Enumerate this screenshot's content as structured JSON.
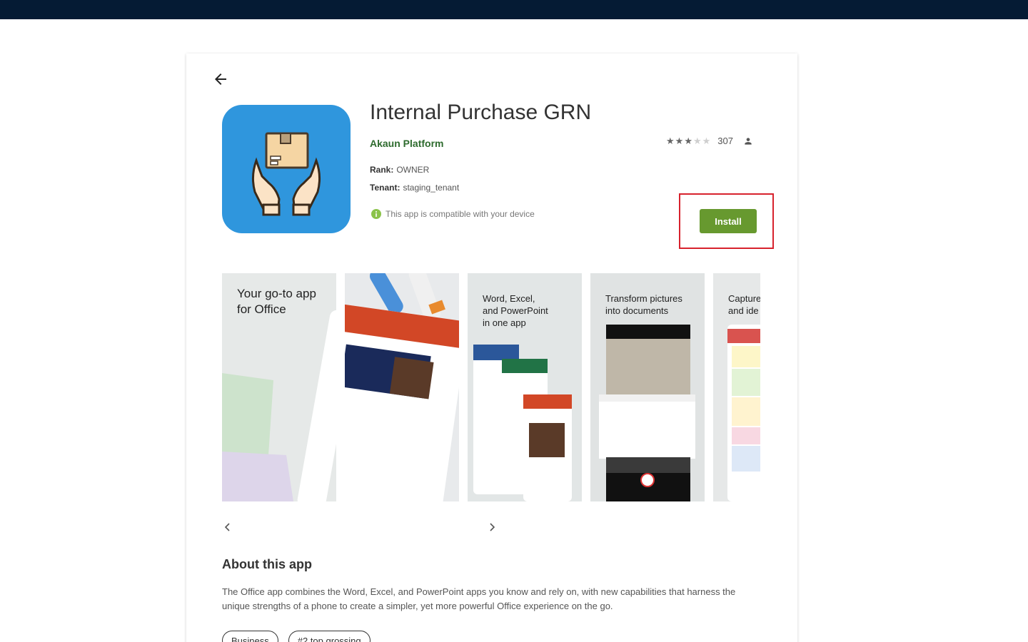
{
  "app": {
    "title": "Internal Purchase GRN",
    "developer": "Akaun Platform",
    "rating_stars": 3,
    "rating_max": 5,
    "rating_count": "307",
    "rank_label": "Rank:",
    "rank_value": "OWNER",
    "tenant_label": "Tenant:",
    "tenant_value": "staging_tenant",
    "compat_text": "This app is compatible with your device",
    "install_label": "Install",
    "icon_bg": "#2f96dd",
    "install_color": "#67992f",
    "highlight_color": "#d7222d"
  },
  "screenshots": [
    {
      "caption": "Your go-to app\nfor Office"
    },
    {
      "caption": ""
    },
    {
      "caption": "Word, Excel,\nand PowerPoint\nin one app"
    },
    {
      "caption": "Transform pictures\ninto documents"
    },
    {
      "caption": "Capture\nand ide"
    }
  ],
  "about": {
    "title": "About this app",
    "text": "The Office app combines the Word, Excel, and PowerPoint apps you know and rely on, with new capabilities that harness the unique strengths of a phone to create a simpler, yet more powerful Office experience on the go."
  },
  "tags": [
    "Business",
    "#2 top grossing"
  ]
}
